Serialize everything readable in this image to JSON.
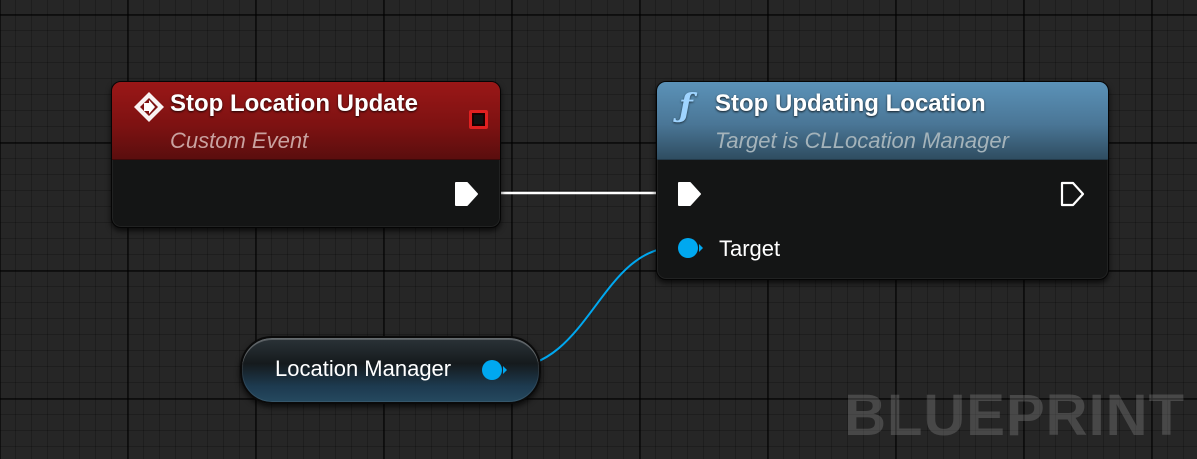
{
  "graph": {
    "watermark": "BLUEPRINT"
  },
  "event_node": {
    "title": "Stop Location Update",
    "subtitle": "Custom Event",
    "icon": "custom-event-icon",
    "header_color": "#8e1414",
    "delegate_pin_color": "#e02020"
  },
  "function_node": {
    "title": "Stop Updating Location",
    "subtitle": "Target is CLLocation Manager",
    "icon": "function-icon",
    "header_color": "#4e7c9e",
    "target_pin_label": "Target"
  },
  "variable_node": {
    "label": "Location Manager",
    "pin_color": "#00a8f0"
  },
  "wires": {
    "exec_color": "#ffffff",
    "object_color": "#00a8f0"
  }
}
